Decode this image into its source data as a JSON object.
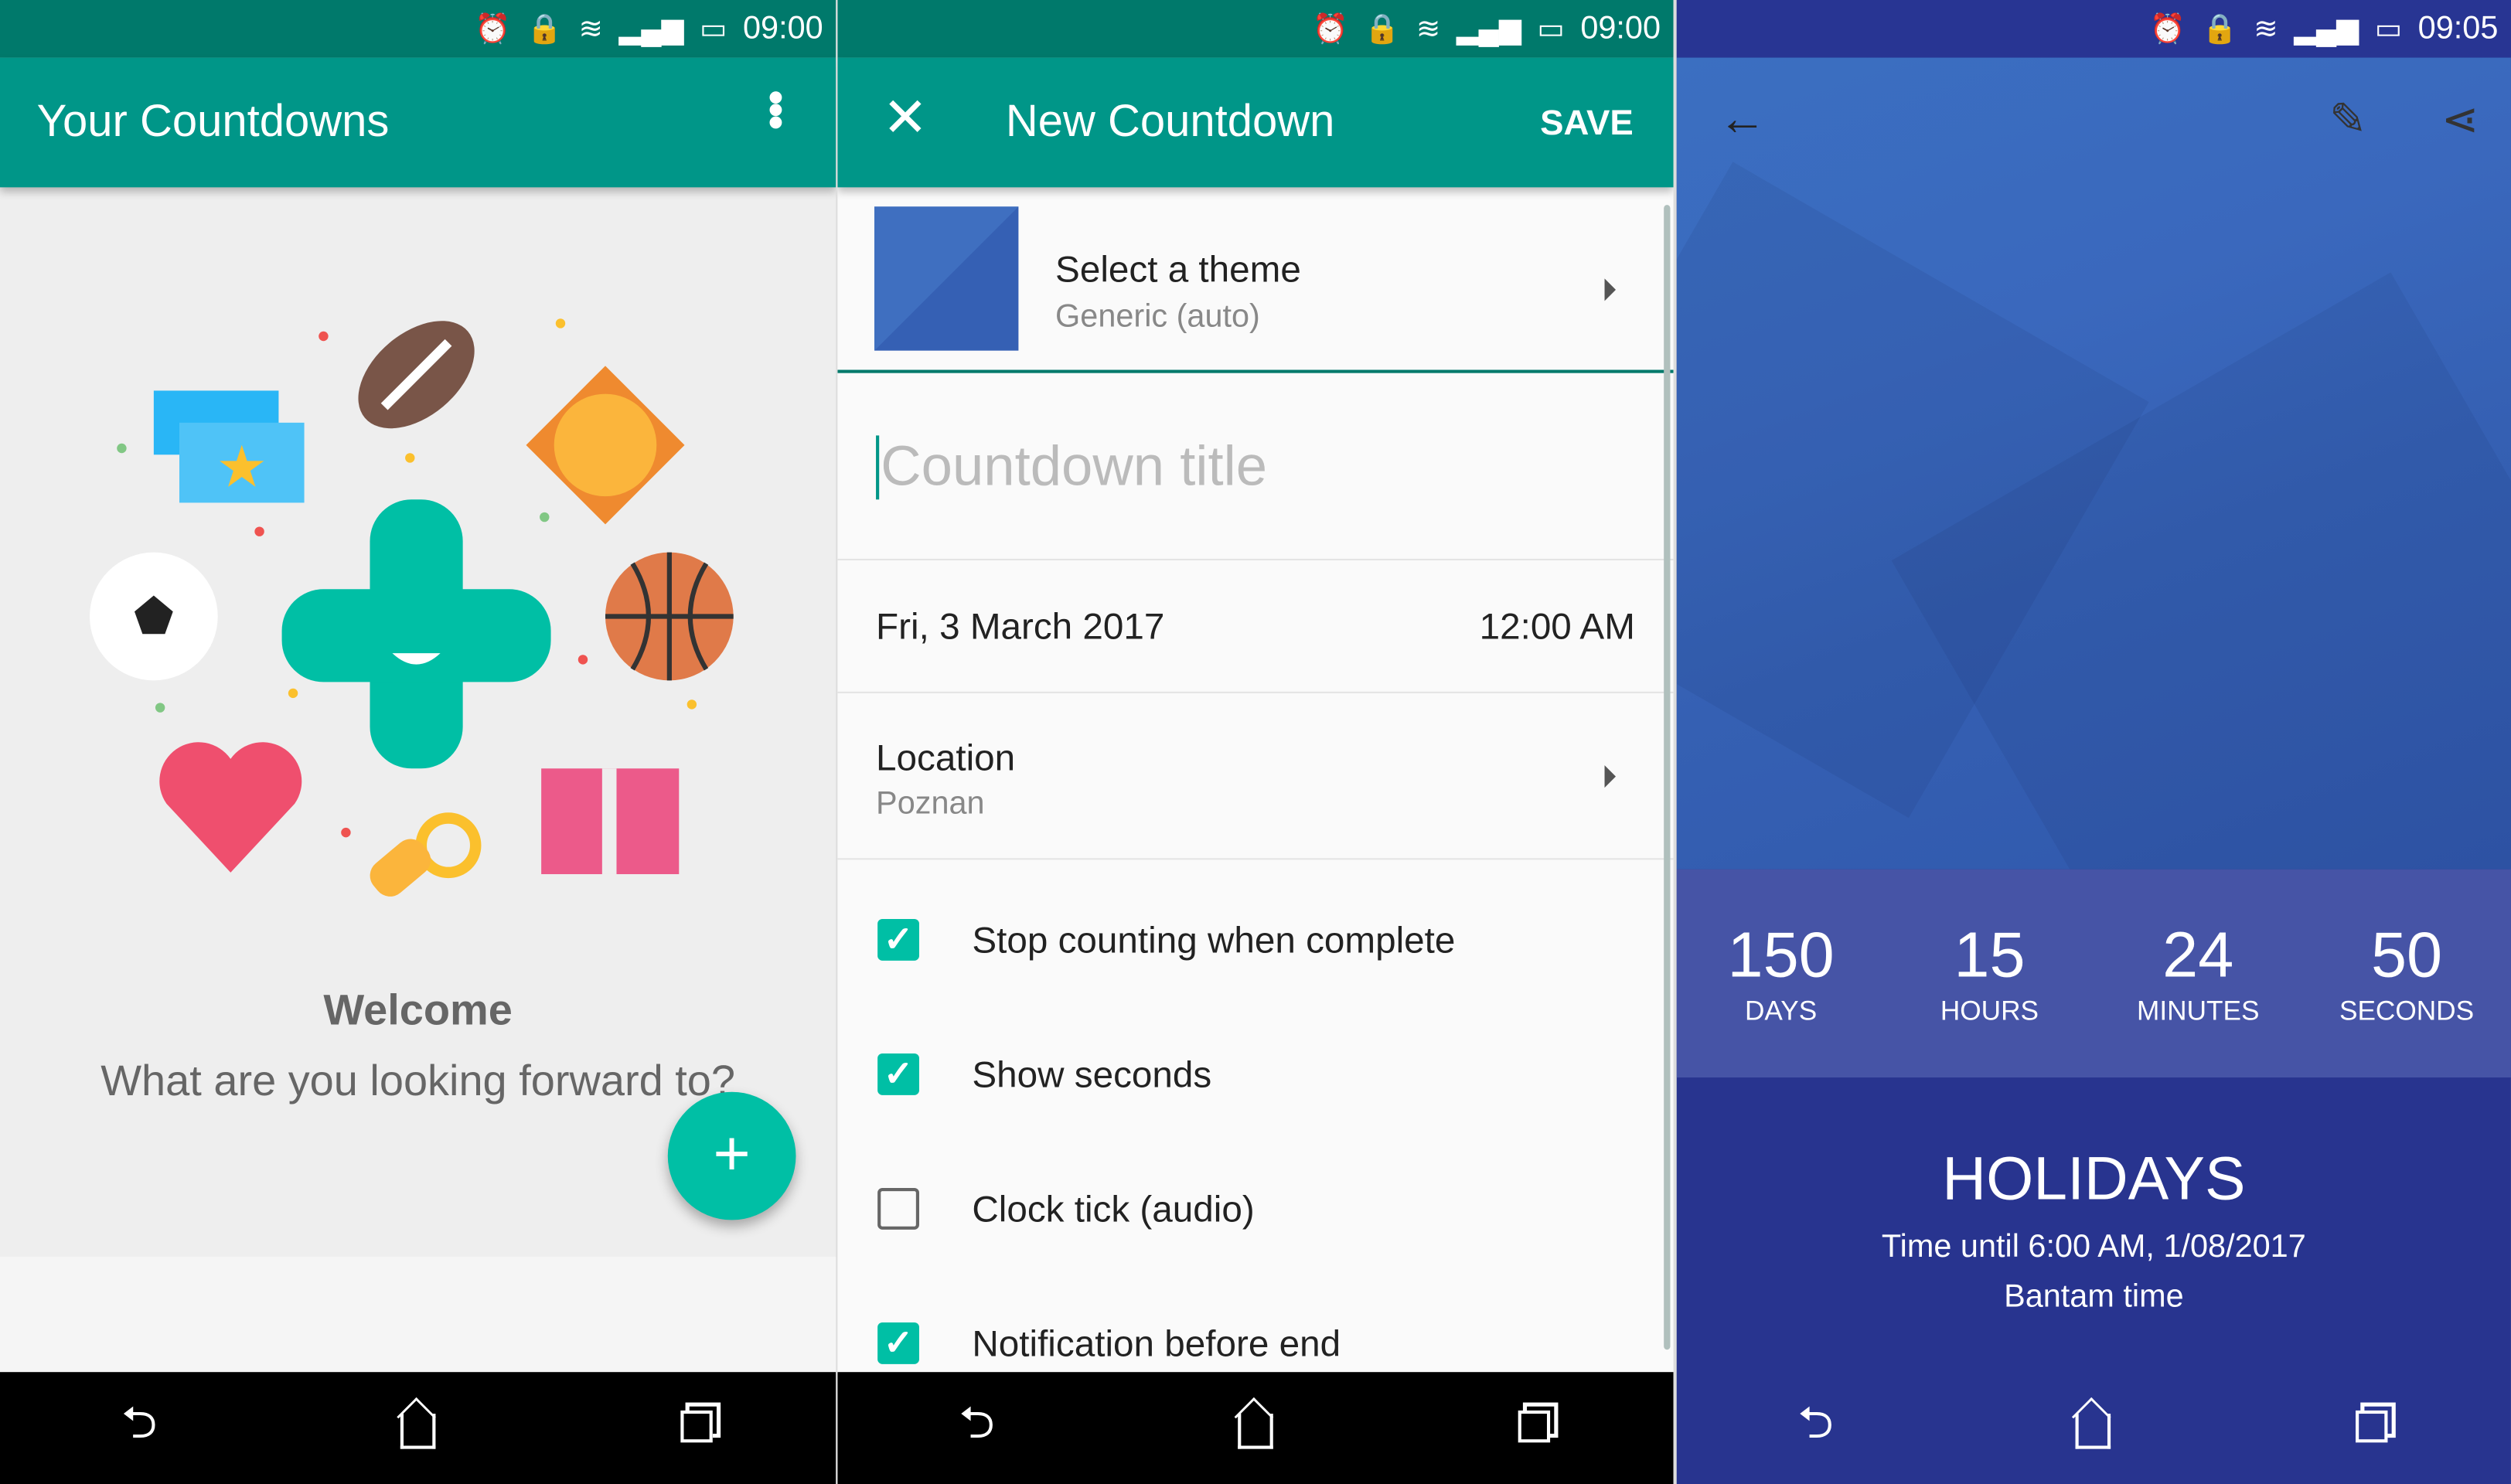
{
  "status_bar": {
    "panels": [
      {
        "time": "09:00"
      },
      {
        "time": "09:00"
      },
      {
        "time": "09:05"
      }
    ],
    "icons": [
      "alarm-icon",
      "lock-icon",
      "wifi-icon",
      "signal-icon",
      "battery-icon"
    ]
  },
  "home": {
    "title": "Your Countdowns",
    "welcome": "Welcome",
    "subtitle": "What are you looking forward to?",
    "fab": "+"
  },
  "editor": {
    "title": "New Countdown",
    "save": "SAVE",
    "theme_label": "Select a theme",
    "theme_value": "Generic (auto)",
    "title_placeholder": "Countdown title",
    "date": "Fri, 3 March 2017",
    "time": "12:00 AM",
    "location_label": "Location",
    "location_value": "Poznan",
    "options": [
      {
        "label": "Stop counting when complete",
        "checked": true
      },
      {
        "label": "Show seconds",
        "checked": true
      },
      {
        "label": "Clock tick (audio)",
        "checked": false
      },
      {
        "label": "Notification before end",
        "checked": true
      }
    ]
  },
  "detail": {
    "counts": [
      {
        "value": "150",
        "unit": "DAYS"
      },
      {
        "value": "15",
        "unit": "HOURS"
      },
      {
        "value": "24",
        "unit": "MINUTES"
      },
      {
        "value": "50",
        "unit": "SECONDS"
      }
    ],
    "name": "HOLIDAYS",
    "until": "Time until 6:00 AM, 1/08/2017",
    "timezone": "Bantam time"
  },
  "colors": {
    "teal_dark": "#00796b",
    "teal": "#009688",
    "accent": "#00bfa5",
    "indigo": "#28348f",
    "indigo_light": "#4654a6"
  }
}
